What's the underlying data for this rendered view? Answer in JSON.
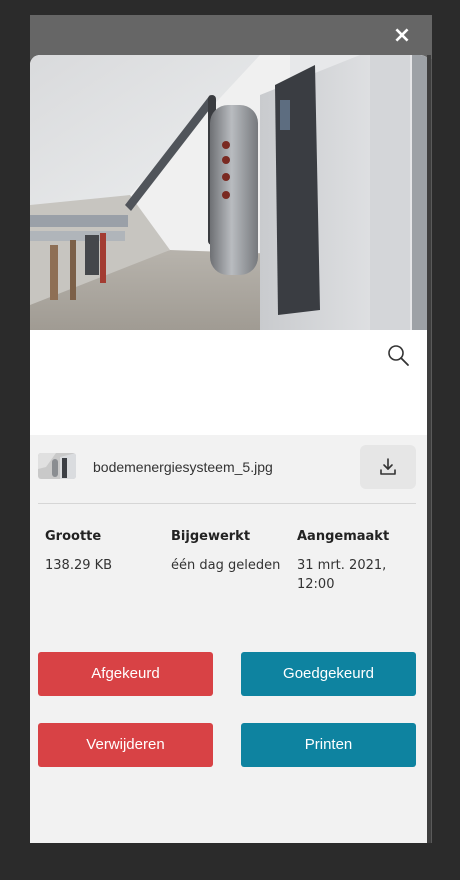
{
  "modal": {
    "close_label": "×"
  },
  "file": {
    "name": "bodemenergiesysteem_5.jpg"
  },
  "meta": {
    "size_label": "Grootte",
    "size_value": "138.29 KB",
    "updated_label": "Bijgewerkt",
    "updated_value": "één dag geleden",
    "created_label": "Aangemaakt",
    "created_value_line1": "31 mrt. 2021,",
    "created_value_line2": "12:00"
  },
  "actions": {
    "reject_label": "Afgekeurd",
    "approve_label": "Goedgekeurd",
    "delete_label": "Verwijderen",
    "print_label": "Printen"
  },
  "colors": {
    "danger": "#d84245",
    "primary": "#0e83a0",
    "overlay": "#2b2b2b",
    "card": "#f2f2f2"
  },
  "icons": {
    "close": "close-icon",
    "zoom": "search-icon",
    "download": "download-icon"
  }
}
